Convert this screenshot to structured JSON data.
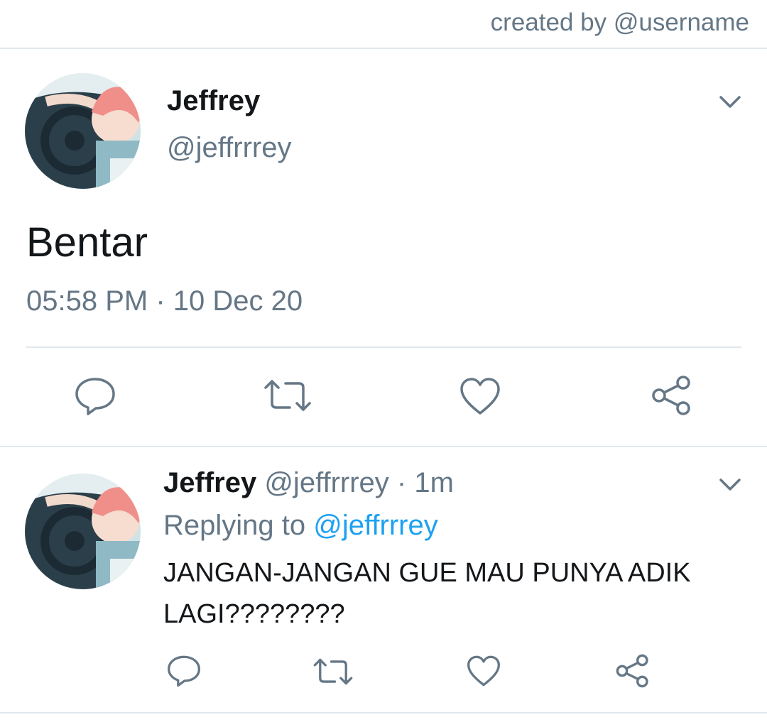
{
  "header": {
    "credit": "created by @username"
  },
  "tweet": {
    "name": "Jeffrey",
    "handle": "@jeffrrrey",
    "text": "Bentar",
    "time": "05:58 PM",
    "separator": "·",
    "date": "10 Dec 20"
  },
  "reply": {
    "name": "Jeffrey",
    "handle": "@jeffrrrey",
    "separator": "·",
    "age": "1m",
    "replying_prefix": "Replying to",
    "replying_to": "@jeffrrrey",
    "text": "JANGAN-JANGAN GUE MAU PUNYA ADIK LAGI????????"
  },
  "icons": {
    "reply": "reply-icon",
    "retweet": "retweet-icon",
    "like": "heart-icon",
    "share": "share-icon",
    "more": "chevron-down-icon"
  },
  "colors": {
    "accent": "#1da1f2",
    "muted": "#657786",
    "text": "#14171a",
    "icon": "#657786",
    "divider": "#e1e8ed"
  }
}
